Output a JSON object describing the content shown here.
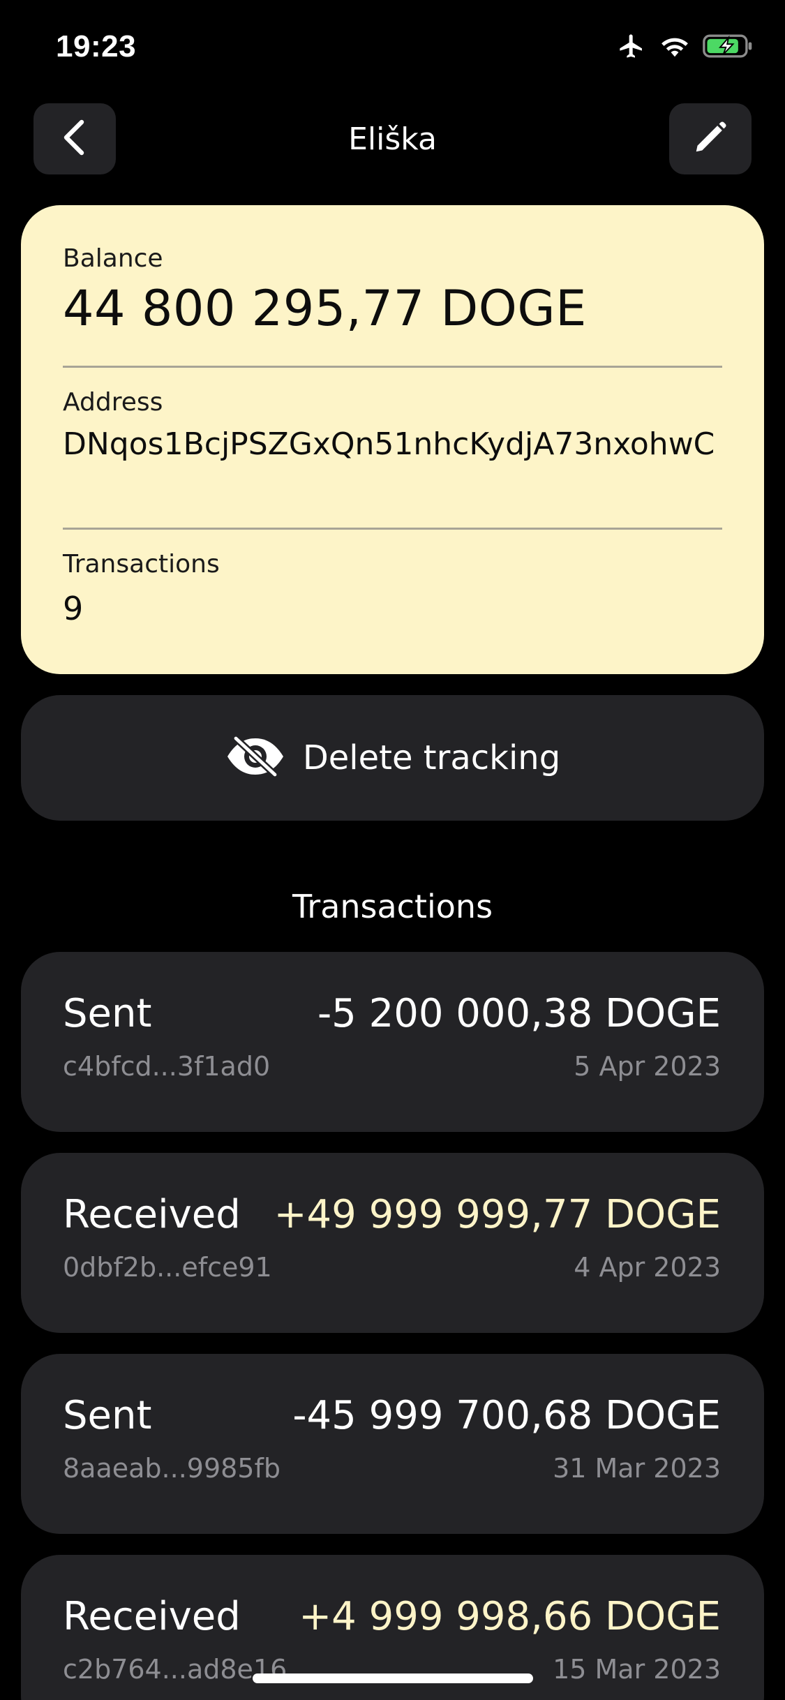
{
  "status_bar": {
    "time": "19:23"
  },
  "nav": {
    "title": "Eliška"
  },
  "wallet": {
    "balance_label": "Balance",
    "balance": "44 800 295,77 DOGE",
    "address_label": "Address",
    "address": "DNqos1BcjPSZGxQn51nhcKydjA73nxohwC",
    "transactions_label": "Transactions",
    "transactions_count": "9"
  },
  "actions": {
    "delete_tracking": "Delete tracking"
  },
  "transactions_section": {
    "title": "Transactions"
  },
  "transactions": [
    {
      "type": "Sent",
      "amount": "-5 200 000,38 DOGE",
      "hash": "c4bfcd...3f1ad0",
      "date": "5 Apr 2023",
      "direction": "out"
    },
    {
      "type": "Received",
      "amount": "+49 999 999,77 DOGE",
      "hash": "0dbf2b...efce91",
      "date": "4 Apr 2023",
      "direction": "in"
    },
    {
      "type": "Sent",
      "amount": "-45 999 700,68 DOGE",
      "hash": "8aaeab...9985fb",
      "date": "31 Mar 2023",
      "direction": "out"
    },
    {
      "type": "Received",
      "amount": "+4 999 998,66 DOGE",
      "hash": "c2b764...ad8e16",
      "date": "15 Mar 2023",
      "direction": "in"
    }
  ],
  "icons": {
    "back": "chevron-left-icon",
    "edit": "pencil-icon",
    "delete": "eye-slash-icon",
    "airplane": "airplane-icon",
    "wifi": "wifi-icon",
    "battery": "battery-charging-icon"
  },
  "colors": {
    "background": "#000000",
    "card": "#232326",
    "accent": "#fdf4c8",
    "secondary_text": "#8e8e93",
    "battery": "#4cd964"
  }
}
